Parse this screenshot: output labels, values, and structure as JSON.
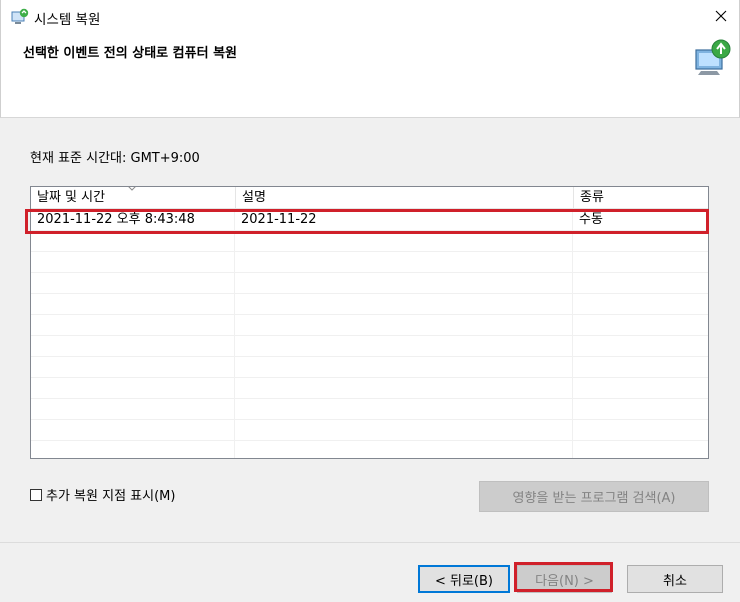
{
  "window": {
    "title": "시스템 복원",
    "heading": "선택한 이벤트 전의 상태로 컴퓨터 복원",
    "app_icon": "system-restore-icon",
    "close_glyph": "✕"
  },
  "timezone_label": "현재 표준 시간대: GMT+9:00",
  "table": {
    "columns": [
      "날짜 및 시간",
      "설명",
      "종류"
    ],
    "rows": [
      {
        "datetime": "2021-11-22 오후 8:43:48",
        "description": "2021-11-22",
        "type": "수동"
      }
    ]
  },
  "options": {
    "show_more_label": "추가 복원 지점 표시(M)",
    "show_more_checked": false,
    "scan_button": "영향을 받는 프로그램 검색(A)"
  },
  "buttons": {
    "back": "< 뒤로(B)",
    "next": "다음(N) >",
    "cancel": "취소"
  },
  "highlight_color": "#d0202a"
}
